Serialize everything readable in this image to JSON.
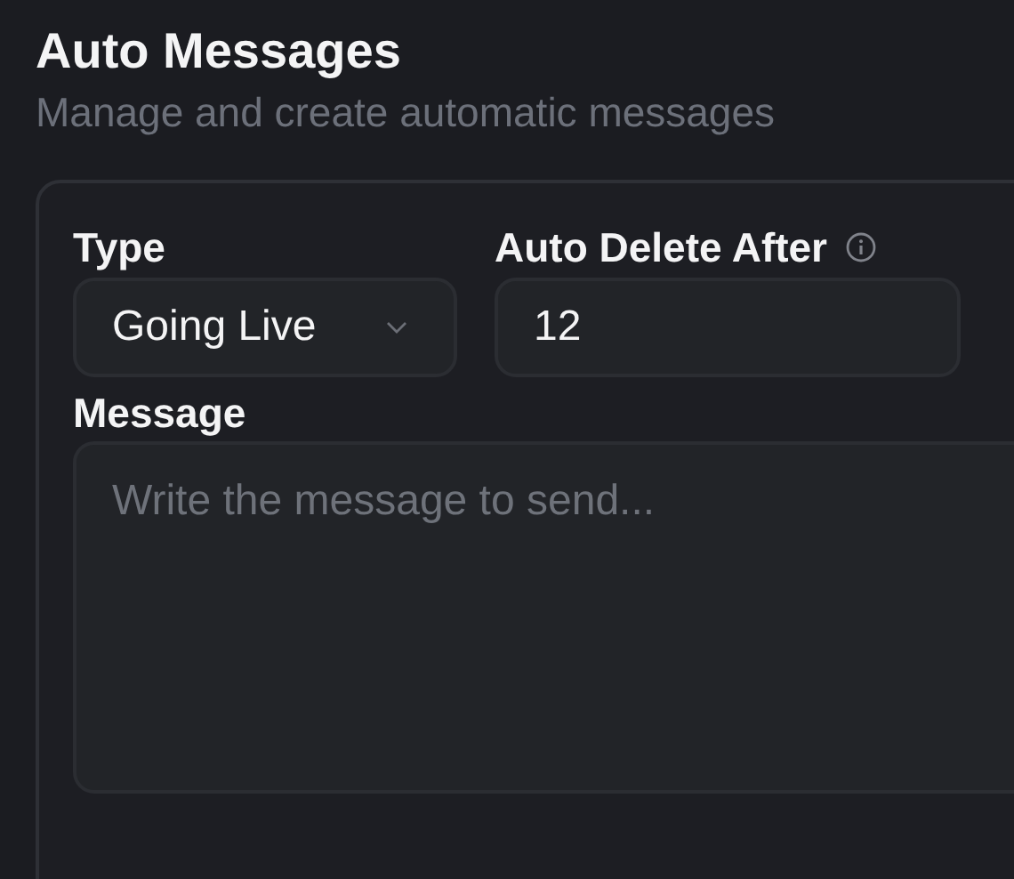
{
  "header": {
    "title": "Auto Messages",
    "subtitle": "Manage and create automatic messages"
  },
  "form": {
    "type_field": {
      "label": "Type",
      "value": "Going Live"
    },
    "delete_field": {
      "label": "Auto Delete After",
      "value": "12"
    },
    "message_field": {
      "label": "Message",
      "placeholder": "Write the message to send..."
    }
  }
}
